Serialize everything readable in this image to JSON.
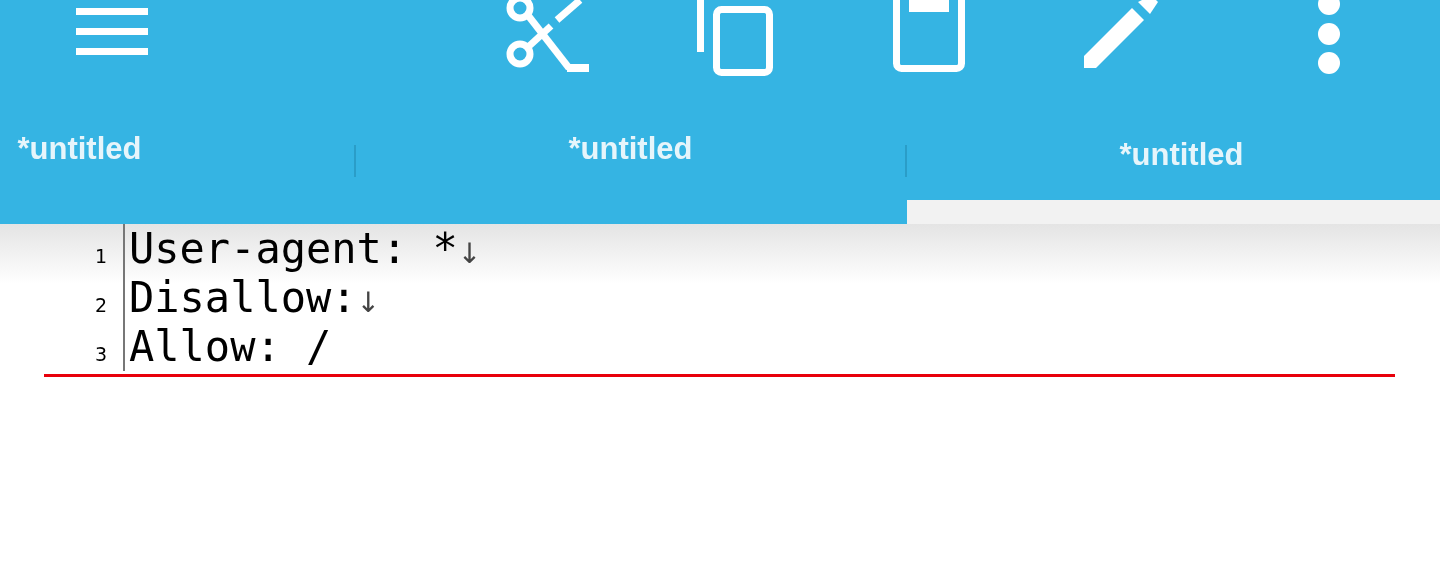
{
  "tabs": [
    {
      "label": "*untitled",
      "selected": false
    },
    {
      "label": "*untitled",
      "selected": false
    },
    {
      "label": "*untitled",
      "selected": true
    }
  ],
  "editor": {
    "lines": [
      {
        "number": "1",
        "text": "User-agent: *",
        "eol": "↓"
      },
      {
        "number": "2",
        "text": "Disallow:",
        "eol": "↓"
      },
      {
        "number": "3",
        "text": "Allow: /"
      }
    ]
  }
}
